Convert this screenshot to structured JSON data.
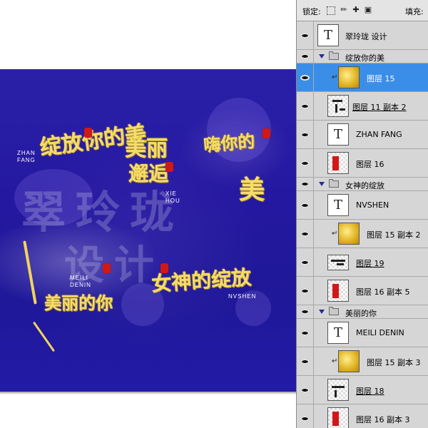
{
  "lock_bar": {
    "lock_label": "锁定:",
    "fill_label": "填充:",
    "icons": [
      "lock-transparent-pixels-icon",
      "lock-image-pixels-icon",
      "lock-position-icon",
      "lock-all-icon"
    ]
  },
  "layers": [
    {
      "name": "翠玲珑 设计",
      "kind": "text"
    },
    {
      "name": "绽放你的美",
      "kind": "group"
    },
    {
      "name": "图层 15",
      "kind": "gold",
      "clipped": true,
      "selected": true
    },
    {
      "name": "图层 11 副本 2",
      "kind": "art"
    },
    {
      "name": "ZHAN FANG",
      "kind": "text"
    },
    {
      "name": "图层 16",
      "kind": "seal"
    },
    {
      "name": "女神的绽放",
      "kind": "group"
    },
    {
      "name": "NVSHEN",
      "kind": "text"
    },
    {
      "name": "图层 15 副本 2",
      "kind": "gold",
      "clipped": true
    },
    {
      "name": "图层 19",
      "kind": "art"
    },
    {
      "name": "图层 16 副本 5",
      "kind": "seal"
    },
    {
      "name": "美丽的你",
      "kind": "group"
    },
    {
      "name": "MEILI DENIN",
      "kind": "text"
    },
    {
      "name": "图层 15 副本 3",
      "kind": "gold",
      "clipped": true
    },
    {
      "name": "图层 18",
      "kind": "art"
    },
    {
      "name": "图层 16 副本 3",
      "kind": "seal"
    }
  ],
  "artwork": {
    "watermark_line1": "翠玲珑",
    "watermark_line2": "设计",
    "phrase1": "绽放你的美",
    "phrase1_sub": "ZHAN",
    "phrase1_sub2": "FANG",
    "phrase2a": "美丽",
    "phrase2b": "邂逅",
    "phrase2_sub": "XIE",
    "phrase2_sub2": "HOU",
    "phrase3a": "嗨你的",
    "phrase3b": "美",
    "phrase4": "美丽的你",
    "phrase4_sub": "MEILI",
    "phrase4_sub2": "DENIN",
    "phrase5": "女神的绽放",
    "phrase5_sub": "NVSHEN"
  }
}
